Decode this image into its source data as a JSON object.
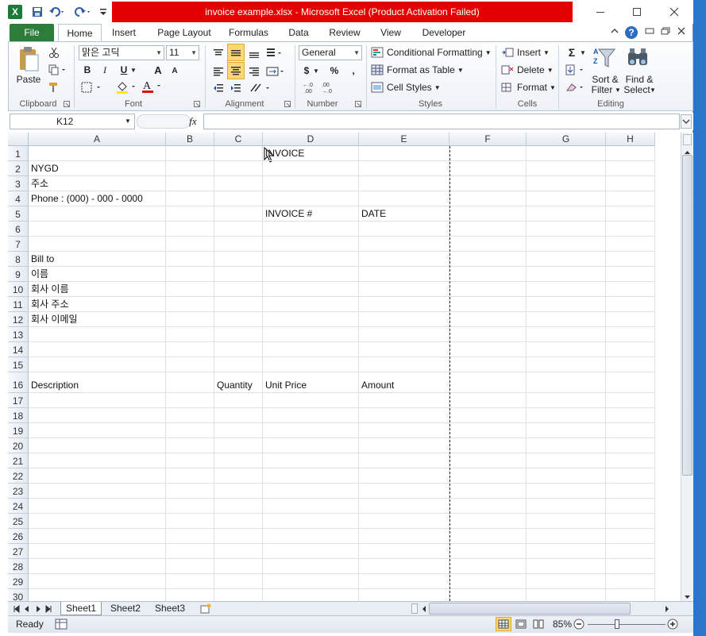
{
  "window": {
    "title": "invoice example.xlsx  -  Microsoft Excel (Product Activation Failed)"
  },
  "tabs": [
    "Home",
    "Insert",
    "Page Layout",
    "Formulas",
    "Data",
    "Review",
    "View",
    "Developer"
  ],
  "file_tab": "File",
  "ribbon": {
    "clipboard": {
      "label": "Clipboard",
      "paste": "Paste"
    },
    "font": {
      "label": "Font",
      "name": "맑은 고딕",
      "size": "11",
      "bold": "B",
      "italic": "I",
      "underline": "U",
      "grow": "A",
      "shrink": "A"
    },
    "alignment": {
      "label": "Alignment"
    },
    "number": {
      "label": "Number",
      "format": "General",
      "currency": "$",
      "percent": "%",
      "comma": ","
    },
    "styles": {
      "label": "Styles",
      "conditional": "Conditional Formatting",
      "table": "Format as Table",
      "cell_styles": "Cell Styles"
    },
    "cells": {
      "label": "Cells",
      "insert": "Insert",
      "delete": "Delete",
      "format": "Format"
    },
    "editing": {
      "label": "Editing",
      "sigma": "Σ",
      "sort": "Sort &",
      "sort2": "Filter",
      "find": "Find &",
      "find2": "Select"
    }
  },
  "formula": {
    "namebox": "K12",
    "fx": "fx",
    "value": ""
  },
  "columns": [
    "A",
    "B",
    "C",
    "D",
    "E",
    "F",
    "G",
    "H"
  ],
  "rows": [
    "1",
    "2",
    "3",
    "4",
    "5",
    "6",
    "7",
    "8",
    "9",
    "10",
    "11",
    "12",
    "13",
    "14",
    "15",
    "16",
    "17",
    "18",
    "19",
    "20",
    "21",
    "22",
    "23",
    "24",
    "25",
    "26",
    "27",
    "28",
    "29",
    "30"
  ],
  "cells": {
    "D1": "INVOICE",
    "A2": "NYGD",
    "A3": "주소",
    "A4": "Phone : (000) - 000 - 0000",
    "D5": "INVOICE #",
    "E5": "DATE",
    "A8": "Bill to",
    "A9": "이름",
    "A10": "회사 이름",
    "A11": "회사 주소",
    "A12": "회사 이메일",
    "A16": "Description",
    "C16": "Quantity",
    "D16": "Unit Price",
    "E16": "Amount"
  },
  "sheets": [
    "Sheet1",
    "Sheet2",
    "Sheet3"
  ],
  "status": {
    "ready": "Ready",
    "zoom": "85%"
  },
  "colors": {
    "file_tab": "#2d7d3a",
    "title_warning": "#e30000",
    "selected_button": "#fbd874"
  }
}
